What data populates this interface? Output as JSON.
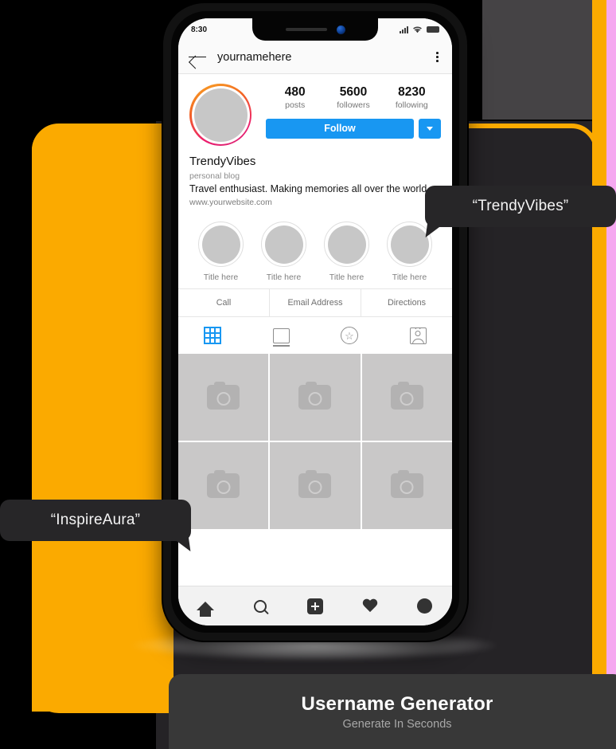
{
  "theme": {
    "orange": "#FBAA00",
    "pink": "#F5A8F0",
    "dark_panel": "#252326",
    "dark_surround": "#454345",
    "bubble_bg": "#272628",
    "accent_blue": "#1897F2"
  },
  "phone": {
    "status_bar": {
      "time": "8:30",
      "icons": [
        "signal-icon",
        "wifi-icon",
        "battery-icon"
      ]
    },
    "header": {
      "back_icon": "back-arrow-icon",
      "title": "yournamehere",
      "menu_icon": "kebab-menu-icon"
    },
    "profile": {
      "avatar": "profile-avatar",
      "stats": [
        {
          "value": "480",
          "label": "posts"
        },
        {
          "value": "5600",
          "label": "followers"
        },
        {
          "value": "8230",
          "label": "following"
        }
      ],
      "follow_label": "Follow",
      "dropdown_icon": "chevron-down-icon",
      "name": "TrendyVibes",
      "category": "personal blog",
      "bio": "Travel enthusiast. Making memories all over the world.",
      "website": "www.yourwebsite.com"
    },
    "highlights": [
      {
        "label": "Title here"
      },
      {
        "label": "Title here"
      },
      {
        "label": "Title here"
      },
      {
        "label": "Title here"
      }
    ],
    "actions": [
      "Call",
      "Email Address",
      "Directions"
    ],
    "tabs": [
      {
        "icon": "grid-icon",
        "active": true
      },
      {
        "icon": "igtv-icon",
        "active": false
      },
      {
        "icon": "star-circle-icon",
        "active": false
      },
      {
        "icon": "tagged-person-icon",
        "active": false
      }
    ],
    "grid_cells": [
      "camera-placeholder",
      "camera-placeholder",
      "camera-placeholder",
      "camera-placeholder",
      "camera-placeholder",
      "camera-placeholder"
    ],
    "bottom_nav": [
      {
        "icon": "home-icon"
      },
      {
        "icon": "search-icon"
      },
      {
        "icon": "add-post-icon"
      },
      {
        "icon": "heart-activity-icon"
      },
      {
        "icon": "profile-avatar-icon"
      }
    ]
  },
  "callouts": {
    "right_bubble": "“TrendyVibes”",
    "left_bubble": "“InspireAura”"
  },
  "title_card": {
    "heading": "Username Generator",
    "subheading": "Generate In Seconds"
  }
}
